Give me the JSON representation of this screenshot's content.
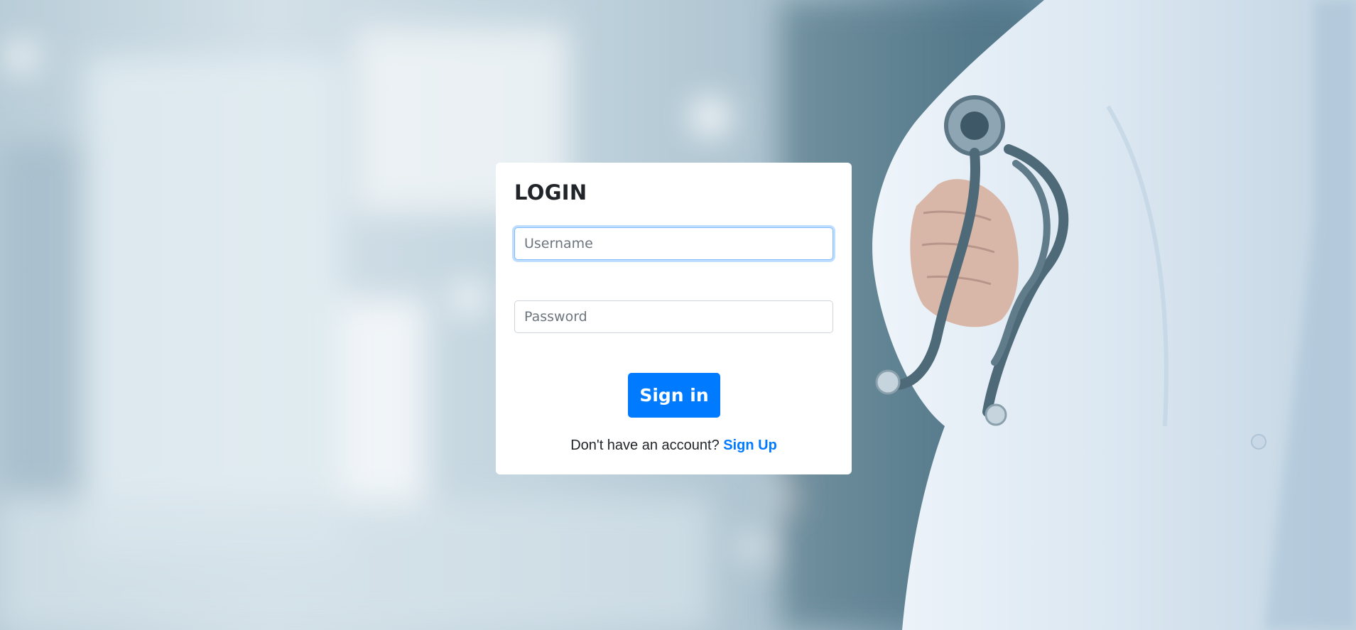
{
  "login": {
    "title": "LOGIN",
    "username_placeholder": "Username",
    "password_placeholder": "Password",
    "submit_label": "Sign in",
    "signup_prompt": "Don't have an account?",
    "signup_link": "Sign Up"
  },
  "colors": {
    "primary": "#007bff",
    "card_bg": "#ffffff",
    "title_text": "#212529"
  },
  "background": {
    "icon": "doctor-with-stethoscope-photo"
  }
}
